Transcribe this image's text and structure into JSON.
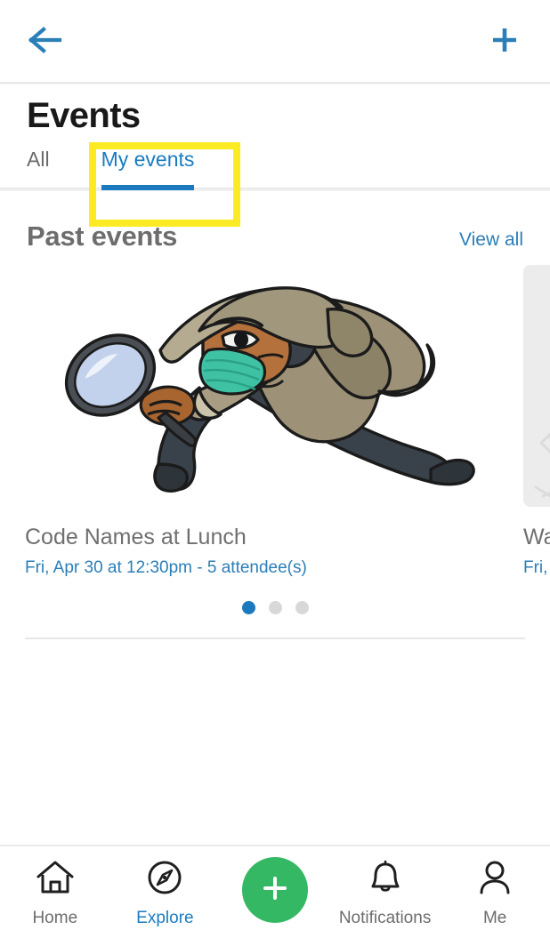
{
  "topbar": {
    "back_icon": "arrow-left-icon",
    "add_icon": "plus-icon",
    "accent": "#2a7fb8"
  },
  "header": {
    "title": "Events"
  },
  "tabs": {
    "items": [
      {
        "label": "All",
        "active": false
      },
      {
        "label": "My events",
        "active": true
      }
    ],
    "active_color": "#1a7cc0",
    "underline_color": "#1b79bd",
    "highlight_color": "#fbeb25"
  },
  "section": {
    "title": "Past events",
    "view_all_label": "View all"
  },
  "cards": [
    {
      "title": "Code Names at Lunch",
      "meta": "Fri, Apr 30 at 12:30pm - 5 attendee(s)",
      "media": "detective-illustration"
    },
    {
      "title": "Wall",
      "meta": "Fri, F",
      "media": "champagne-placeholder"
    }
  ],
  "pagination": {
    "dots": 3,
    "active_index": 0,
    "active_color": "#1b79bd",
    "inactive_color": "#d8d8d8"
  },
  "bottomnav": {
    "items": [
      {
        "label": "Home",
        "icon": "home-icon",
        "active": false
      },
      {
        "label": "Explore",
        "icon": "compass-icon",
        "active": true
      },
      {
        "label": "Notifications",
        "icon": "bell-icon",
        "active": false
      },
      {
        "label": "Me",
        "icon": "person-icon",
        "active": false
      }
    ],
    "fab": {
      "icon": "plus-icon",
      "color": "#34b864"
    }
  }
}
